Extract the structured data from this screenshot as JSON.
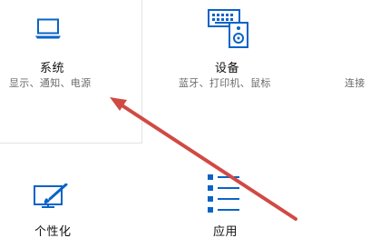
{
  "tiles": {
    "system": {
      "title": "系统",
      "description": "显示、通知、电源",
      "icon": "laptop-icon"
    },
    "devices": {
      "title": "设备",
      "description": "蓝牙、打印机、鼠标",
      "icon": "keyboard-speaker-icon"
    },
    "network": {
      "description": "连接"
    },
    "personalization": {
      "title": "个性化",
      "icon": "monitor-brush-icon"
    },
    "apps": {
      "title": "应用",
      "icon": "app-list-icon"
    }
  },
  "colors": {
    "accent": "#0a63c7",
    "arrow": "#d04a43",
    "title": "#111111",
    "description": "#6b6b6b"
  }
}
